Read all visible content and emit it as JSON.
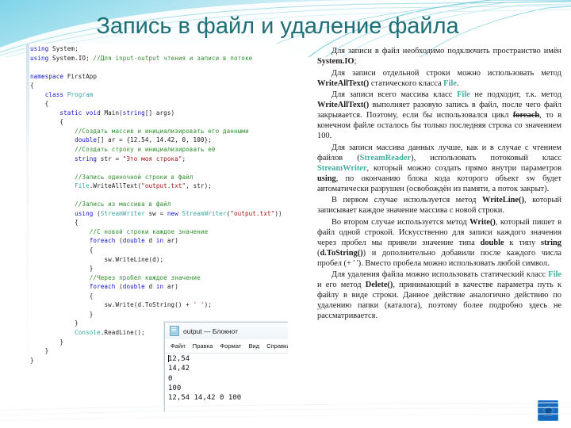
{
  "slide": {
    "title": "Запись в файл и удаление файла",
    "accent_color": "#1f6f78",
    "header_gradient_from": "#7fd4e8",
    "header_gradient_to": "#ffffff"
  },
  "code_pane": {
    "language": "C#",
    "lines": [
      "using System;",
      "using System.IO; //Для input-output чтения и записи в потоке",
      "",
      "namespace FirstApp",
      "{",
      "    class Program",
      "    {",
      "        static void Main(string[] args)",
      "        {",
      "            //Создать массив и инициализировать его данными",
      "            double[] ar = {12.54, 14.42, 0, 100};",
      "            //Создать строку и инициализировать её",
      "            string str = \"Это моя строка\";",
      "",
      "            //Запись одиночной строки в файл",
      "            File.WriteAllText(\"output.txt\", str);",
      "",
      "            //Запись из массива в файл",
      "            using (StreamWriter sw = new StreamWriter(\"output.txt\"))",
      "            {",
      "                //С новой строки каждое значение",
      "                foreach (double d in ar)",
      "                {",
      "                    sw.WriteLine(d);",
      "                }",
      "                //Через пробел каждое значение",
      "                foreach (double d in ar)",
      "                {",
      "                    sw.Write(d.ToString() + ' ');",
      "                }",
      "            }",
      "            Console.ReadLine();",
      "        }",
      "    }",
      "}"
    ]
  },
  "notepad": {
    "title": "output — Блокнот",
    "icon": "notepad-icon",
    "menu": [
      "Файл",
      "Правка",
      "Формат",
      "Вид",
      "Справка"
    ],
    "content_lines": [
      "12,54",
      "14,42",
      "0",
      "100",
      "12,54 14,42 0 100"
    ]
  },
  "body_text": {
    "paragraphs": [
      [
        {
          "t": "Для записи в файл необходимо подключить пространство имён ",
          "style": "normal"
        },
        {
          "t": "System.IO",
          "style": "bold"
        },
        {
          "t": ";",
          "style": "normal"
        }
      ],
      [
        {
          "t": "Для записи отдельной строки можно использовать метод ",
          "style": "normal"
        },
        {
          "t": "WriteAllText()",
          "style": "bold"
        },
        {
          "t": " статического класса ",
          "style": "normal"
        },
        {
          "t": "File",
          "style": "teal"
        },
        {
          "t": ".",
          "style": "normal"
        }
      ],
      [
        {
          "t": "Для записи всего массива класс ",
          "style": "normal"
        },
        {
          "t": "File",
          "style": "teal"
        },
        {
          "t": " не подходит, т.к. метод ",
          "style": "normal"
        },
        {
          "t": "WriteAllText()",
          "style": "bold"
        },
        {
          "t": " выполняет разовую запись в файл, после чего файл закрывается. Поэтому, если бы использовался цикл ",
          "style": "normal"
        },
        {
          "t": "foreach",
          "style": "strike"
        },
        {
          "t": ", то в конечном файле осталось бы только последняя строка со значением 100.",
          "style": "normal"
        }
      ],
      [
        {
          "t": "Для записи массива данных лучше, как и в случае с чтением файлов (",
          "style": "normal"
        },
        {
          "t": "StreamReader",
          "style": "teal"
        },
        {
          "t": "), использовать потоковый класс ",
          "style": "normal"
        },
        {
          "t": "StreamWriter",
          "style": "teal"
        },
        {
          "t": ", который можно создать прямо внутри параметров ",
          "style": "normal"
        },
        {
          "t": "using",
          "style": "bold"
        },
        {
          "t": ", по окончанию блока кода которого объект sw будет автоматически разрушен (освобождён из памяти, а поток закрыт).",
          "style": "normal"
        }
      ],
      [
        {
          "t": "В первом случае используется метод ",
          "style": "normal"
        },
        {
          "t": "WriteLine()",
          "style": "bold"
        },
        {
          "t": ", который записывает каждое значение массива с новой строки.",
          "style": "normal"
        }
      ],
      [
        {
          "t": "Во втором случае используется метод ",
          "style": "normal"
        },
        {
          "t": "Write()",
          "style": "bold"
        },
        {
          "t": ", который пишет в файл одной строкой. Искусственно для записи каждого значения через пробел мы привели значение типа ",
          "style": "normal"
        },
        {
          "t": "double",
          "style": "bold"
        },
        {
          "t": " к типу ",
          "style": "normal"
        },
        {
          "t": "string",
          "style": "bold"
        },
        {
          "t": " (",
          "style": "normal"
        },
        {
          "t": "d.ToString()",
          "style": "bold"
        },
        {
          "t": ") и дополнительно добавили после каждого числа пробел (+ ' '). Вместо пробела можно использовать любой символ.",
          "style": "normal"
        }
      ],
      [
        {
          "t": "Для удаления файла можно использовать статический класс ",
          "style": "normal"
        },
        {
          "t": "File",
          "style": "teal"
        },
        {
          "t": " и его метод ",
          "style": "normal"
        },
        {
          "t": "Delete()",
          "style": "bold"
        },
        {
          "t": ", принимающий в качестве параметра путь к файлу в виде строки. Данное действие аналогично действию по удалению папки (каталога), поэтому более подробно здесь не рассматривается.",
          "style": "normal"
        }
      ]
    ]
  },
  "home_button": {
    "icon": "home-icon",
    "color": "#1668b8"
  }
}
